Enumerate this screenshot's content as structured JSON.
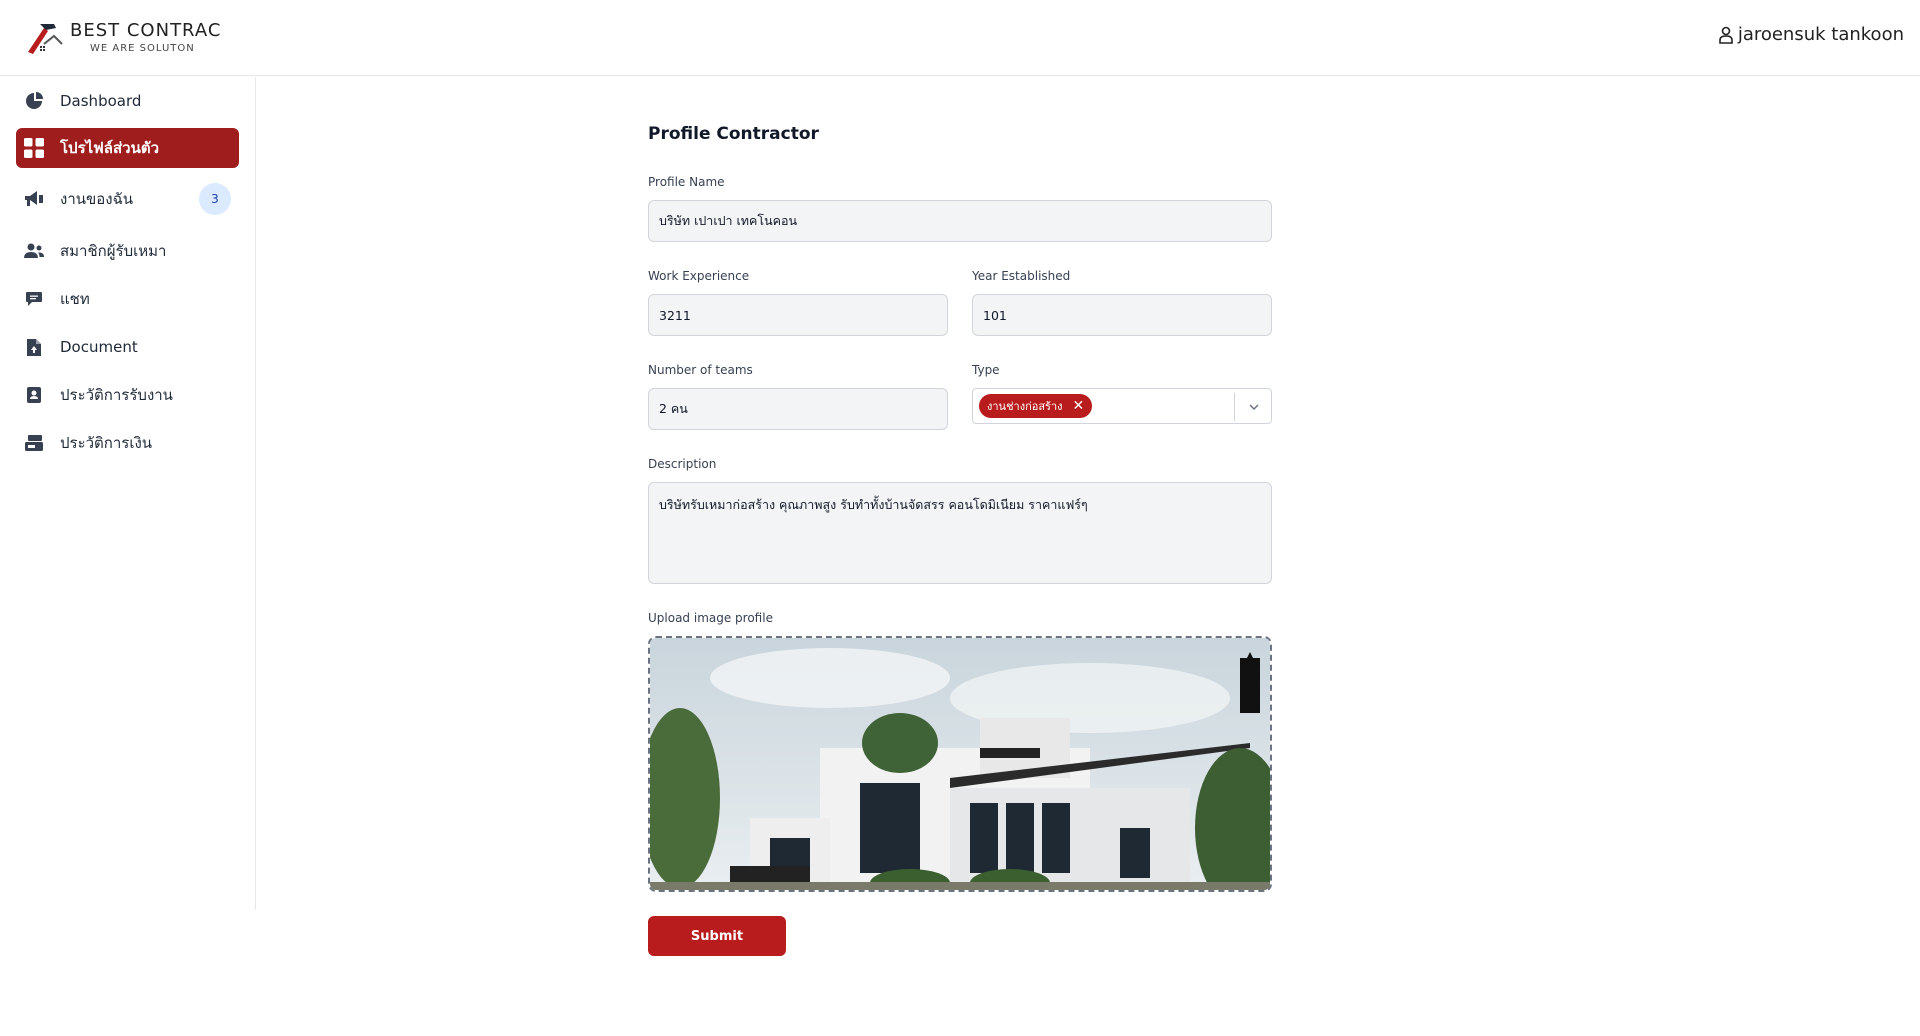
{
  "brand": {
    "title": "BEST CONTRAC",
    "subtitle": "WE ARE SOLUTON"
  },
  "user": {
    "name": "jaroensuk tankoon"
  },
  "sidebar": {
    "items": [
      {
        "label": "Dashboard",
        "icon": "pie-chart-icon"
      },
      {
        "label": "โปรไฟล์ส่วนตัว",
        "icon": "grid-icon",
        "active": true
      },
      {
        "label": "งานของฉัน",
        "icon": "megaphone-icon",
        "badge": "3"
      },
      {
        "label": "สมาชิกผู้รับเหมา",
        "icon": "users-icon"
      },
      {
        "label": "แชท",
        "icon": "chat-icon"
      },
      {
        "label": "Document",
        "icon": "document-icon"
      },
      {
        "label": "ประวัติการรับงาน",
        "icon": "contact-card-icon"
      },
      {
        "label": "ประวัติการเงิน",
        "icon": "cash-register-icon"
      }
    ]
  },
  "form": {
    "title": "Profile Contractor",
    "profile_name": {
      "label": "Profile Name",
      "value": "บริษัท เปาเปา เทคโนคอน"
    },
    "work_experience": {
      "label": "Work Experience",
      "value": "3211"
    },
    "year_established": {
      "label": "Year Established",
      "value": "101"
    },
    "number_of_teams": {
      "label": "Number of teams",
      "value": "2 คน"
    },
    "type": {
      "label": "Type",
      "selected": "งานช่างก่อสร้าง"
    },
    "description": {
      "label": "Description",
      "value": "บริษัทรับเหมาก่อสร้าง คุณภาพสูง รับทำทั้งบ้านจัดสรร คอนโดมิเนียม ราคาแฟร์ๆ"
    },
    "upload": {
      "label": "Upload image profile"
    },
    "submit_label": "Submit"
  },
  "colors": {
    "primary": "#b91c1c",
    "active_nav": "#9f1d1d",
    "badge_bg": "#dbeafe"
  }
}
